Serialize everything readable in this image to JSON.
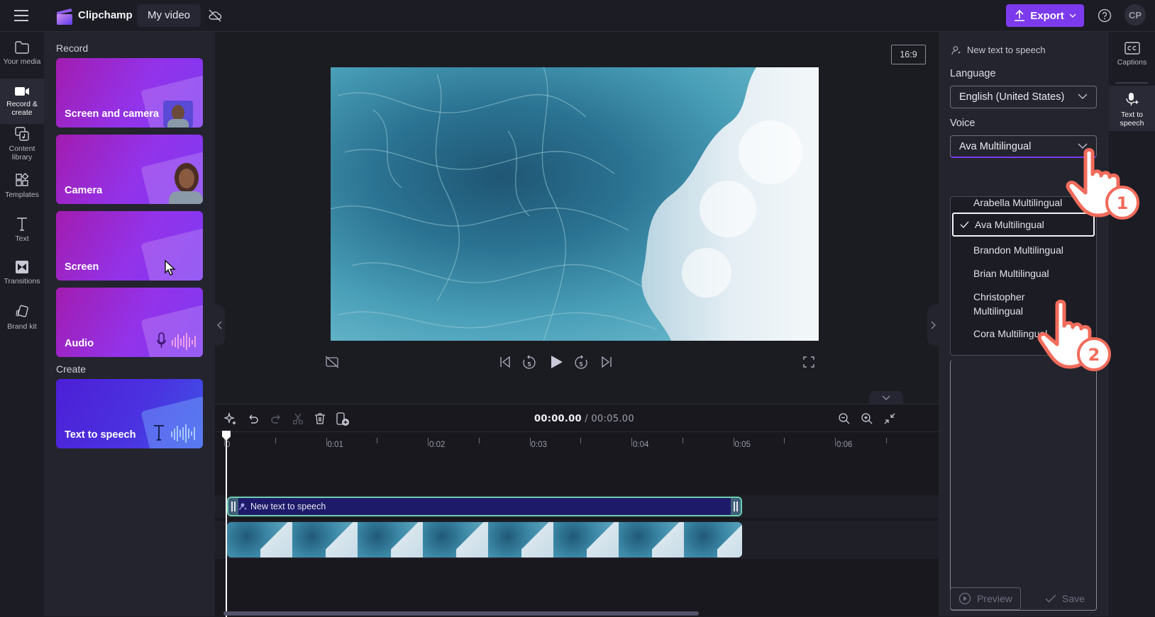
{
  "app": {
    "brand": "Clipchamp",
    "project_name": "My video",
    "export_label": "Export",
    "avatar_initials": "CP",
    "accent_color": "#7c3aed"
  },
  "left_rail": {
    "items": [
      {
        "label": "Your media",
        "icon": "folder-icon"
      },
      {
        "label": "Record & create",
        "icon": "camera-icon",
        "active": true
      },
      {
        "label": "Content library",
        "icon": "content-library-icon"
      },
      {
        "label": "Templates",
        "icon": "templates-icon"
      },
      {
        "label": "Text",
        "icon": "text-icon"
      },
      {
        "label": "Transitions",
        "icon": "transitions-icon"
      },
      {
        "label": "Brand kit",
        "icon": "brand-kit-icon"
      }
    ]
  },
  "record_panel": {
    "record_heading": "Record",
    "create_heading": "Create",
    "cards": [
      {
        "label": "Screen and camera"
      },
      {
        "label": "Camera"
      },
      {
        "label": "Screen"
      },
      {
        "label": "Audio"
      },
      {
        "label": "Text to speech"
      }
    ]
  },
  "preview": {
    "aspect_ratio": "16:9"
  },
  "timeline": {
    "current_time": "00:00.00",
    "separator": " / ",
    "total_time": "00:05.00",
    "ruler_labels": [
      "0",
      "0:01",
      "0:02",
      "0:03",
      "0:04",
      "0:05",
      "0:06"
    ],
    "tts_clip_label": "New text to speech",
    "scroll_fraction": 0.67
  },
  "properties": {
    "header": "New text to speech",
    "language_label": "Language",
    "language_value": "English (United States)",
    "voice_label": "Voice",
    "voice_value": "Ava Multilingual",
    "voice_options": [
      {
        "label": "Arabella Multilingual",
        "selected": false
      },
      {
        "label": "Ava Multilingual",
        "selected": true
      },
      {
        "label": "Brandon Multilingual",
        "selected": false
      },
      {
        "label": "Brian Multilingual",
        "selected": false
      },
      {
        "label": "Christopher Multilingual",
        "selected": false
      },
      {
        "label": "Cora Multilingual",
        "selected": false
      }
    ],
    "preview_label": "Preview",
    "save_label": "Save"
  },
  "right_rail": {
    "items": [
      {
        "label": "Captions",
        "icon": "captions-icon"
      },
      {
        "label": "Text to speech",
        "icon": "text-to-speech-icon",
        "active": true
      }
    ]
  },
  "annotations": {
    "step1": "1",
    "step2": "2",
    "pointer_color": "#f26b5b"
  }
}
